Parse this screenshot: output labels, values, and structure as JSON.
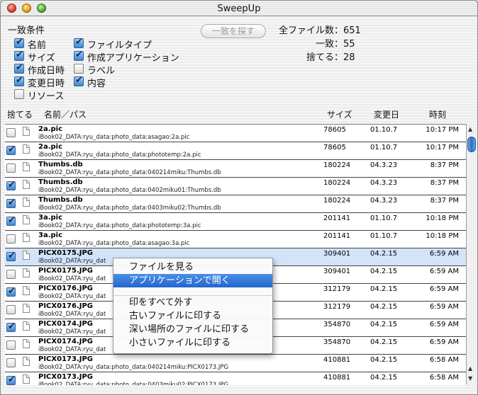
{
  "window": {
    "title": "SweepUp"
  },
  "criteria": {
    "label": "一致条件",
    "left": [
      {
        "label": "名前",
        "checked": true
      },
      {
        "label": "サイズ",
        "checked": true
      },
      {
        "label": "作成日時",
        "checked": true
      },
      {
        "label": "変更日時",
        "checked": true
      },
      {
        "label": "リソース",
        "checked": false
      }
    ],
    "right": [
      {
        "label": "ファイルタイプ",
        "checked": true
      },
      {
        "label": "作成アプリケーション",
        "checked": true
      },
      {
        "label": "ラベル",
        "checked": false
      },
      {
        "label": "内容",
        "checked": true
      }
    ]
  },
  "find_button": {
    "label": "一致を探す"
  },
  "stats": {
    "total": "全ファイル数：651",
    "matched": "一致：55",
    "discard": "捨てる：28"
  },
  "columns": {
    "discard": "捨てる",
    "name_path": "名前／パス",
    "size": "サイズ",
    "modified": "変更日",
    "time": "時刻"
  },
  "rows": [
    {
      "checked": false,
      "name": "2a.pic",
      "path": "iBook02_DATA:ryu_data:photo_data:asagao:2a.pic",
      "size": "78605",
      "date": "01.10.7",
      "time": "10:17 PM",
      "selected": false
    },
    {
      "checked": true,
      "name": "2a.pic",
      "path": "iBook02_DATA:ryu_data:photo_data:phototemp:2a.pic",
      "size": "78605",
      "date": "01.10.7",
      "time": "10:17 PM",
      "selected": false
    },
    {
      "checked": false,
      "name": "Thumbs.db",
      "path": "iBook02_DATA:ryu_data:photo_data:040214miku:Thumbs.db",
      "size": "180224",
      "date": "04.3.23",
      "time": "8:37 PM",
      "selected": false
    },
    {
      "checked": true,
      "name": "Thumbs.db",
      "path": "iBook02_DATA:ryu_data:photo_data:0402miku01:Thumbs.db",
      "size": "180224",
      "date": "04.3.23",
      "time": "8:37 PM",
      "selected": false
    },
    {
      "checked": true,
      "name": "Thumbs.db",
      "path": "iBook02_DATA:ryu_data:photo_data:0403miku02:Thumbs.db",
      "size": "180224",
      "date": "04.3.23",
      "time": "8:37 PM",
      "selected": false
    },
    {
      "checked": true,
      "name": "3a.pic",
      "path": "iBook02_DATA:ryu_data:photo_data:phototemp:3a.pic",
      "size": "201141",
      "date": "01.10.7",
      "time": "10:18 PM",
      "selected": false
    },
    {
      "checked": false,
      "name": "3a.pic",
      "path": "iBook02_DATA:ryu_data:photo_data:asagao:3a.pic",
      "size": "201141",
      "date": "01.10.7",
      "time": "10:18 PM",
      "selected": false
    },
    {
      "checked": true,
      "name": "PICX0175.JPG",
      "path": "iBook02_DATA:ryu_dat",
      "size": "309401",
      "date": "04.2.15",
      "time": "6:59 AM",
      "selected": true
    },
    {
      "checked": false,
      "name": "PICX0175.JPG",
      "path": "iBook02_DATA:ryu_dat",
      "size": "309401",
      "date": "04.2.15",
      "time": "6:59 AM",
      "selected": false
    },
    {
      "checked": true,
      "name": "PICX0176.JPG",
      "path": "iBook02_DATA:ryu_dat",
      "size": "312179",
      "date": "04.2.15",
      "time": "6:59 AM",
      "selected": false
    },
    {
      "checked": false,
      "name": "PICX0176.JPG",
      "path": "iBook02_DATA:ryu_dat",
      "size": "312179",
      "date": "04.2.15",
      "time": "6:59 AM",
      "selected": false
    },
    {
      "checked": true,
      "name": "PICX0174.JPG",
      "path": "iBook02_DATA:ryu_dat",
      "size": "354870",
      "date": "04.2.15",
      "time": "6:59 AM",
      "selected": false
    },
    {
      "checked": false,
      "name": "PICX0174.JPG",
      "path": "iBook02_DATA:ryu_dat",
      "size": "354870",
      "date": "04.2.15",
      "time": "6:59 AM",
      "selected": false
    },
    {
      "checked": false,
      "name": "PICX0173.JPG",
      "path": "iBook02_DATA:ryu_data:photo_data:040214miku:PICX0173.JPG",
      "size": "410881",
      "date": "04.2.15",
      "time": "6:58 AM",
      "selected": false
    },
    {
      "checked": true,
      "name": "PICX0173.JPG",
      "path": "iBook02_DATA:ryu_data:photo_data:0403miku02:PICX0173.JPG",
      "size": "410881",
      "date": "04.2.15",
      "time": "6:58 AM",
      "selected": false
    }
  ],
  "context_menu": {
    "items": [
      {
        "label": "ファイルを見る",
        "highlighted": false
      },
      {
        "label": "アプリケーションで開く",
        "highlighted": true
      },
      {
        "label": "印をすべて外す",
        "highlighted": false
      },
      {
        "label": "古いファイルに印する",
        "highlighted": false
      },
      {
        "label": "深い場所のファイルに印する",
        "highlighted": false
      },
      {
        "label": "小さいファイルに印する",
        "highlighted": false
      }
    ]
  }
}
